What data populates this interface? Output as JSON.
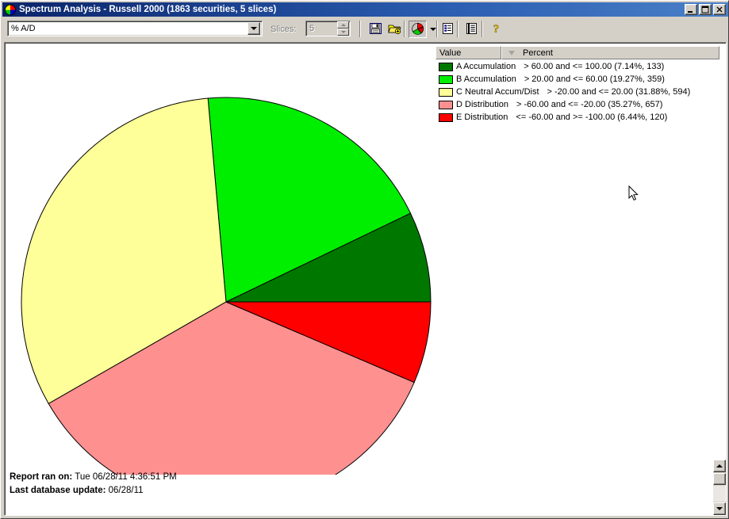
{
  "window": {
    "title": "Spectrum Analysis - Russell 2000 (1863 securities, 5 slices)",
    "icon": "app-pie-icon",
    "minimize_label": "_",
    "maximize_label": "□",
    "close_label": "✕"
  },
  "toolbar": {
    "field_selector": {
      "value": "% A/D",
      "icon": "chevron-down-icon"
    },
    "slices": {
      "label": "Slices:",
      "value": "5"
    },
    "buttons": [
      {
        "name": "save-button",
        "icon": "floppy-disk-icon",
        "pressed": false
      },
      {
        "name": "open-button",
        "icon": "folder-add-icon",
        "pressed": false
      },
      {
        "name": "chart-type-button",
        "icon": "pie-chart-icon",
        "pressed": true
      },
      {
        "name": "chart-type-dropdown",
        "icon": "chevron-down-icon",
        "pressed": false
      },
      {
        "name": "report-view-button",
        "icon": "list-view-icon",
        "pressed": false
      },
      {
        "name": "detail-view-button",
        "icon": "detail-list-icon",
        "pressed": false
      },
      {
        "name": "help-button",
        "icon": "question-mark-icon",
        "pressed": false
      }
    ]
  },
  "legend": {
    "columns": [
      "Value",
      "Percent"
    ],
    "sort": {
      "column": "Percent",
      "direction": "descending",
      "icon": "triangle-down-icon"
    },
    "rows": [
      {
        "label": "A Accumulation",
        "range": "> 60.00 and <= 100.00 (7.14%, 133)",
        "color": "#007800"
      },
      {
        "label": "B Accumulation",
        "range": "> 20.00 and <= 60.00 (19.27%, 359)",
        "color": "#00ee00"
      },
      {
        "label": "C Neutral Accum/Dist",
        "range": "> -20.00 and <= 20.00 (31.88%, 594)",
        "color": "#ffff99"
      },
      {
        "label": "D Distribution",
        "range": "> -60.00 and <= -20.00 (35.27%, 657)",
        "color": "#ff9090"
      },
      {
        "label": "E Distribution",
        "range": "<= -60.00 and >= -100.00 (6.44%, 120)",
        "color": "#ff0000"
      }
    ]
  },
  "footer": {
    "report_ran_label": "Report ran on:",
    "report_ran_value": "Tue 06/28/11 4:36:51 PM",
    "last_update_label": "Last database update:",
    "last_update_value": "06/28/11"
  },
  "scrollbar": {
    "up_icon": "triangle-up-icon",
    "down_icon": "triangle-down-icon"
  },
  "chart_data": {
    "type": "pie",
    "title": "Spectrum Analysis - Russell 2000",
    "subtitle": "1863 securities, 5 slices",
    "metric": "% A/D",
    "total_securities": 1863,
    "slice_count": 5,
    "categories": [
      "A Accumulation",
      "B Accumulation",
      "C Neutral Accum/Dist",
      "D Distribution",
      "E Distribution"
    ],
    "values": [
      7.14,
      19.27,
      31.88,
      35.27,
      6.44
    ],
    "counts": [
      133,
      359,
      594,
      657,
      120
    ],
    "colors": [
      "#007800",
      "#00ee00",
      "#ffff99",
      "#ff9090",
      "#ff0000"
    ],
    "ranges": [
      "> 60.00 and <= 100.00",
      "> 20.00 and <= 60.00",
      "> -20.00 and <= 20.00",
      "> -60.00 and <= -20.00",
      "<= -60.00 and >= -100.00"
    ],
    "start_angle_deg": 0,
    "direction": "counterclockwise",
    "legend_position": "right",
    "xlabel": "",
    "ylabel": ""
  }
}
